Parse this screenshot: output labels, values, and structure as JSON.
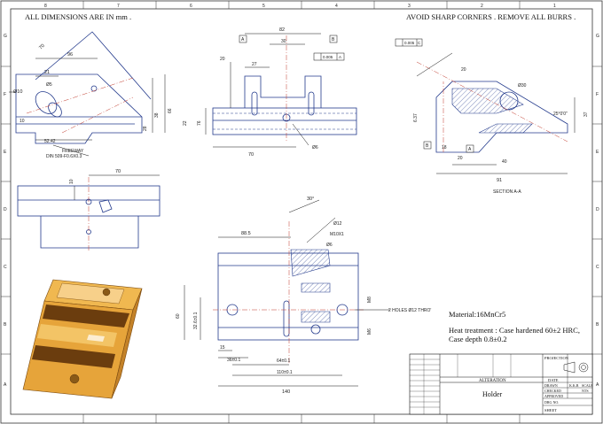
{
  "header": {
    "units_note": "ALL DIMENSIONS ARE IN mm .",
    "burr_note": "AVOID SHARP CORNERS . REMOVE ALL BURRS ."
  },
  "border": {
    "columns_top": [
      "1",
      "2",
      "3",
      "4",
      "5",
      "6",
      "7",
      "8"
    ],
    "rows_left": [
      "G",
      "F",
      "E",
      "D",
      "C",
      "B",
      "A"
    ],
    "rows_right": [
      "G",
      "F",
      "E",
      "D",
      "C",
      "B",
      "A"
    ]
  },
  "front_view": {
    "dims": [
      "96",
      "70",
      "21",
      "Ø10",
      "52.42",
      "38",
      "Ø5",
      "66",
      "28",
      "10"
    ],
    "note_freeway": "FREEWAY",
    "note_din": "DIN 509-F0.6X0.3"
  },
  "top_center_view": {
    "dims": [
      "82",
      "30",
      "27",
      "20",
      "76",
      "70",
      "22",
      "Ø6"
    ],
    "gdt_tol": "0.005",
    "gdt_datum": "A",
    "gdt_label_a": "A",
    "gdt_label_b": "B"
  },
  "section_view": {
    "title": "SECTION  A-A",
    "dims": [
      "20",
      "Ø30",
      "6.37",
      "18",
      "20",
      "40",
      "91",
      "25°0'0\"",
      "37"
    ],
    "gdt_tol": "0.005",
    "gdt_datum": "C",
    "label_b": "B",
    "label_a": "A"
  },
  "side_view": {
    "dims": [
      "70",
      "10"
    ]
  },
  "main_view": {
    "dims": [
      "88.5",
      "30°",
      "Ø12",
      "M10X1",
      "Ø6",
      "60",
      "32.6±0.1",
      "36±0.1",
      "64±0.1",
      "110±0.1",
      "140",
      "15",
      "M8",
      "M6"
    ],
    "holes_note": "2 HOLES Ø12 THRO'"
  },
  "material": {
    "material": "Material:16MnCr5",
    "heat": "Heat treatment : Case hardened  60±2 HRC,",
    "depth": "Case depth 0.8±0.2"
  },
  "title_block": {
    "part_name": "Holder",
    "alteration": "ALTERATION",
    "date": "DATE",
    "drawn": "DRAWN",
    "drawn_by": "K.K.B",
    "checked": "CHECKED",
    "approved": "APPROVED",
    "drg_no": "DRG NO.",
    "sheet": "SHEET",
    "projection": "PROJECTION",
    "scale": "SCALE",
    "scale_value": "NTS"
  },
  "colors": {
    "line": "#233a8c",
    "center": "#c0392b",
    "iso_light": "#e6a43a",
    "iso_dark": "#6b3d0e"
  }
}
